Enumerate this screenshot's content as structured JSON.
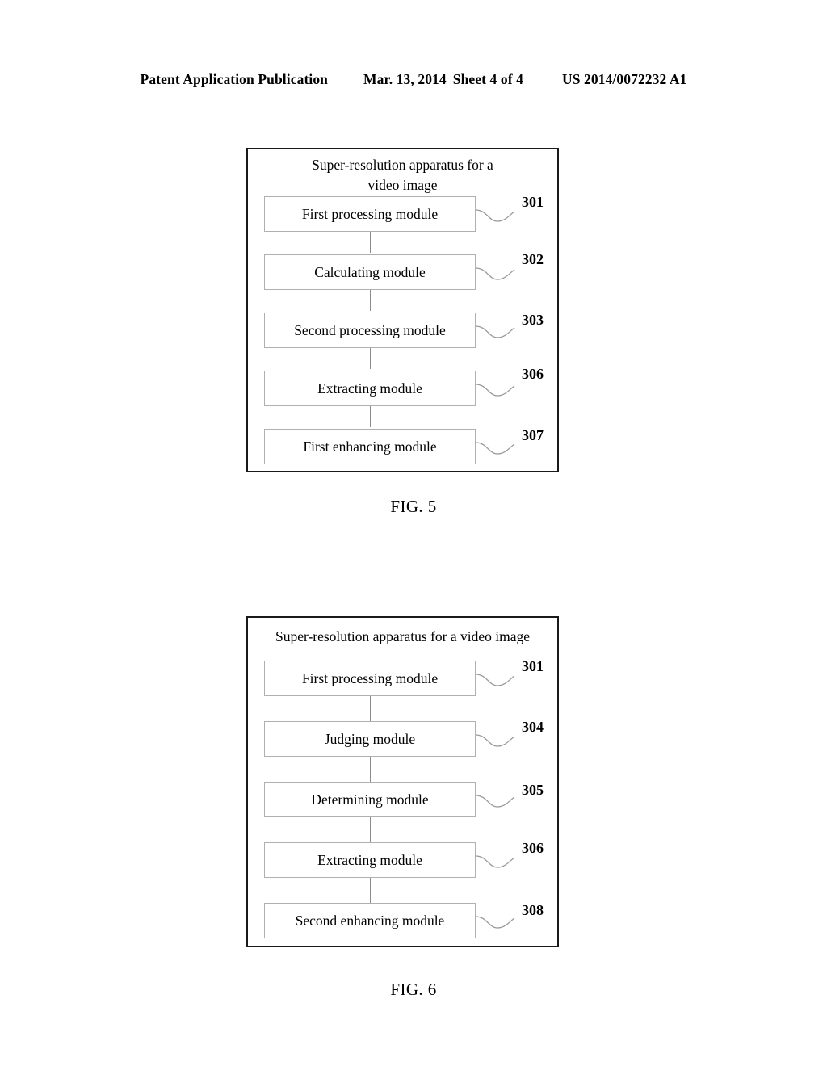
{
  "header": {
    "publication": "Patent Application Publication",
    "date": "Mar. 13, 2014",
    "sheet": "Sheet 4 of 4",
    "patent_number": "US 2014/0072232 A1"
  },
  "figures": [
    {
      "id": "fig5",
      "caption": "FIG. 5",
      "title": "Super-resolution apparatus for a video image",
      "title_lines": [
        "Super-resolution apparatus for a",
        "video image"
      ],
      "modules": [
        {
          "label": "First processing module",
          "ref": "301"
        },
        {
          "label": "Calculating module",
          "ref": "302"
        },
        {
          "label": "Second processing module",
          "ref": "303"
        },
        {
          "label": "Extracting module",
          "ref": "306"
        },
        {
          "label": "First enhancing module",
          "ref": "307"
        }
      ]
    },
    {
      "id": "fig6",
      "caption": "FIG. 6",
      "title": "Super-resolution apparatus for a video image",
      "title_lines": [
        "Super-resolution apparatus for a video image"
      ],
      "modules": [
        {
          "label": "First processing module",
          "ref": "301"
        },
        {
          "label": "Judging module",
          "ref": "304"
        },
        {
          "label": "Determining module",
          "ref": "305"
        },
        {
          "label": "Extracting module",
          "ref": "306"
        },
        {
          "label": "Second enhancing module",
          "ref": "308"
        }
      ]
    }
  ],
  "colors": {
    "frame_border": "#1a1a1a",
    "module_border": "#b0b0b0",
    "connector": "#8c8c8c",
    "leader": "#9a9a9a",
    "text": "#000000",
    "background": "#ffffff"
  }
}
